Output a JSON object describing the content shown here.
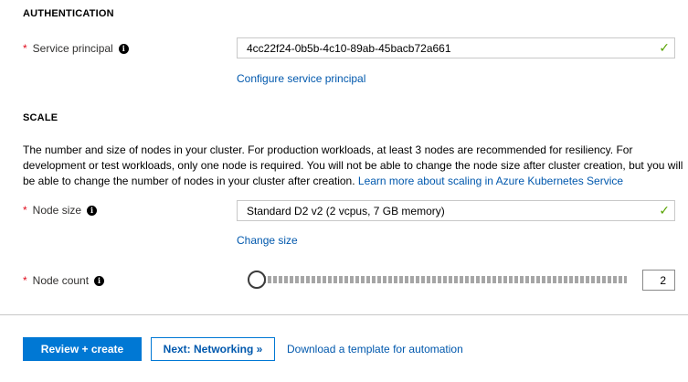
{
  "authentication": {
    "heading": "AUTHENTICATION",
    "service_principal": {
      "label": "Service principal",
      "value": "4cc22f24-0b5b-4c10-89ab-45bacb72a661",
      "configure_link": "Configure service principal"
    }
  },
  "scale": {
    "heading": "SCALE",
    "description": "The number and size of nodes in your cluster. For production workloads, at least 3 nodes are recommended for resiliency. For development or test workloads, only one node is required. You will not be able to change the node size after cluster creation, but you will be able to change the number of nodes in your cluster after creation.",
    "learn_more_link": "Learn more about scaling in Azure Kubernetes Service",
    "node_size": {
      "label": "Node size",
      "value": "Standard D2 v2 (2 vcpus, 7 GB memory)",
      "change_link": "Change size"
    },
    "node_count": {
      "label": "Node count",
      "value": "2"
    }
  },
  "footer": {
    "review_create": "Review + create",
    "next_networking": "Next: Networking »",
    "download_template": "Download a template for automation"
  },
  "symbols": {
    "required": "*",
    "info": "i",
    "check": "✓"
  },
  "colors": {
    "accent": "#0078d4",
    "link": "#0058ad",
    "required": "#e00b1c",
    "valid": "#57a300"
  }
}
